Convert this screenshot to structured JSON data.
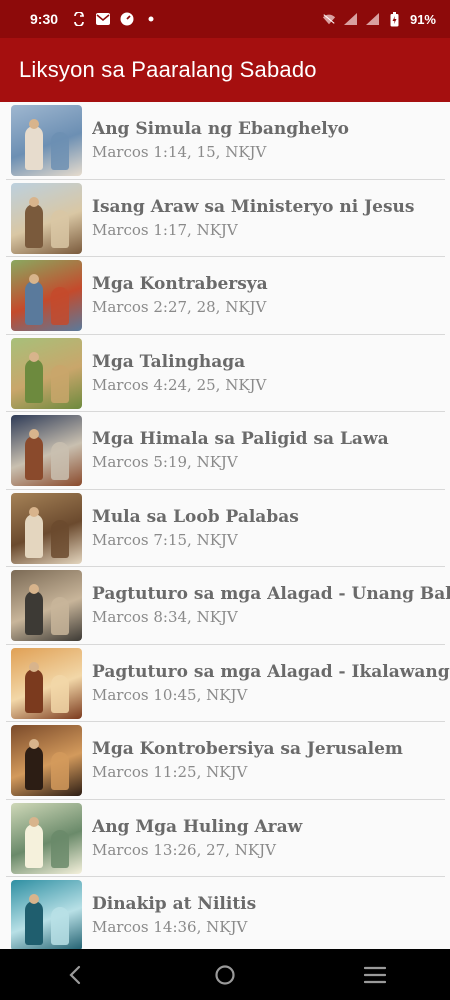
{
  "status_bar": {
    "time": "9:30",
    "battery": "91%"
  },
  "app_bar": {
    "title": "Liksyon sa Paaralang Sabado"
  },
  "lessons": [
    {
      "title": "Ang Simula ng Ebanghelyo",
      "reference": "Marcos 1:14, 15, NKJV",
      "thumb_colors": [
        "#9fb7d0",
        "#e7dccd",
        "#6c8fb3"
      ]
    },
    {
      "title": "Isang Araw sa Ministeryo ni Jesus",
      "reference": "Marcos 1:17, NKJV",
      "thumb_colors": [
        "#bcd0de",
        "#7a5a3c",
        "#d9c7a4"
      ]
    },
    {
      "title": "Mga Kontrabersya",
      "reference": "Marcos 2:27, 28, NKJV",
      "thumb_colors": [
        "#8aa860",
        "#5a7a9c",
        "#c44a2c"
      ]
    },
    {
      "title": "Mga Talinghaga",
      "reference": "Marcos 4:24, 25, NKJV",
      "thumb_colors": [
        "#a7c07a",
        "#6d8a3e",
        "#c9a66b"
      ]
    },
    {
      "title": "Mga Himala sa Paligid sa Lawa",
      "reference": "Marcos 5:19, NKJV",
      "thumb_colors": [
        "#2e3b57",
        "#8a4a2c",
        "#c9c0b0"
      ]
    },
    {
      "title": "Mula sa Loob Palabas",
      "reference": "Marcos 7:15, NKJV",
      "thumb_colors": [
        "#a58257",
        "#e4d6bf",
        "#6b4a2e"
      ]
    },
    {
      "title": "Pagtuturo sa mga Alagad - Unang Bahagi",
      "reference": "Marcos 8:34, NKJV",
      "thumb_colors": [
        "#7b6a55",
        "#3d3a35",
        "#c8b59a"
      ]
    },
    {
      "title": "Pagtuturo sa mga Alagad - Ikalawang Bahagi",
      "reference": "Marcos 10:45, NKJV",
      "thumb_colors": [
        "#e0a055",
        "#7b3a1e",
        "#f2d7a8"
      ]
    },
    {
      "title": "Mga Kontrobersiya sa Jerusalem",
      "reference": "Marcos 11:25, NKJV",
      "thumb_colors": [
        "#7a4a2a",
        "#2c1d14",
        "#d39a5c"
      ]
    },
    {
      "title": "Ang Mga Huling Araw",
      "reference": "Marcos 13:26, 27, NKJV",
      "thumb_colors": [
        "#cfd8b8",
        "#f5f1dc",
        "#6a8a6a"
      ]
    },
    {
      "title": "Dinakip at Nilitis",
      "reference": "Marcos 14:36, NKJV",
      "thumb_colors": [
        "#2f8fa2",
        "#1f5e6e",
        "#b8e0e6"
      ]
    }
  ]
}
